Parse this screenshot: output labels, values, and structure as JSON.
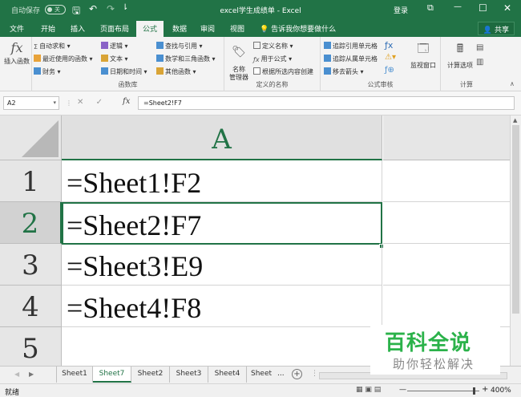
{
  "titlebar": {
    "autosave": "自动保存",
    "autosave_state": "关",
    "title": "excel学生成绩单  -  Excel",
    "login": "登录",
    "save_glyph": "🖫",
    "undo_glyph": "↶",
    "redo_glyph": "↷",
    "customize_glyph": "⇂",
    "ribbon_opts_glyph": "⧉",
    "minimize_glyph": "—",
    "maximize_glyph": "☐",
    "close_glyph": "✕"
  },
  "tabs": [
    "文件",
    "开始",
    "插入",
    "页面布局",
    "公式",
    "数据",
    "审阅",
    "视图"
  ],
  "active_tab": "公式",
  "tell_me": "告诉我你想要做什么",
  "share": "共享",
  "ribbon": {
    "insert_function": "插入函数",
    "fx_glyph": "fx",
    "library": {
      "autosum": "自动求和",
      "recent": "最近使用的函数",
      "financial": "财务",
      "logical": "逻辑",
      "text": "文本",
      "datetime": "日期和时间",
      "lookup": "查找与引用",
      "math": "数学和三角函数",
      "more": "其他函数",
      "label": "函数库"
    },
    "names": {
      "manager": "名称\n管理器",
      "define": "定义名称",
      "use_in_formula": "用于公式",
      "create_from_selection": "根据所选内容创建",
      "label": "定义的名称"
    },
    "auditing": {
      "trace_precedents": "追踪引用单元格",
      "trace_dependents": "追踪从属单元格",
      "remove_arrows": "移去箭头",
      "watch_window": "监视窗口",
      "label": "公式审核"
    },
    "calc": {
      "options": "计算选项",
      "label": "计算"
    }
  },
  "formula_bar": {
    "name_box": "A2",
    "cancel": "✕",
    "enter": "✓",
    "fx": "fx",
    "formula": "=Sheet2!F7"
  },
  "grid": {
    "column": "A",
    "rows": [
      {
        "num": "1",
        "value": "=Sheet1!F2"
      },
      {
        "num": "2",
        "value": "=Sheet2!F7"
      },
      {
        "num": "3",
        "value": "=Sheet3!E9"
      },
      {
        "num": "4",
        "value": "=Sheet4!F8"
      },
      {
        "num": "5",
        "value": ""
      }
    ],
    "active_row": "2"
  },
  "sheets": [
    "Sheet1",
    "Sheet7",
    "Sheet2",
    "Sheet3",
    "Sheet4",
    "Sheet"
  ],
  "active_sheet": "Sheet7",
  "sheet_nav": {
    "prev": "◀",
    "next": "▶",
    "more": "...",
    "add": "+"
  },
  "status": {
    "ready": "就绪",
    "views": "▦  ▣  ▤",
    "zoom_minus": "—",
    "zoom_plus": "+",
    "zoom": "400%"
  },
  "watermark": {
    "title": "百科全说",
    "subtitle": "助你轻松解决"
  },
  "colors": {
    "accent": "#217346",
    "watermark": "#2bb24a"
  }
}
